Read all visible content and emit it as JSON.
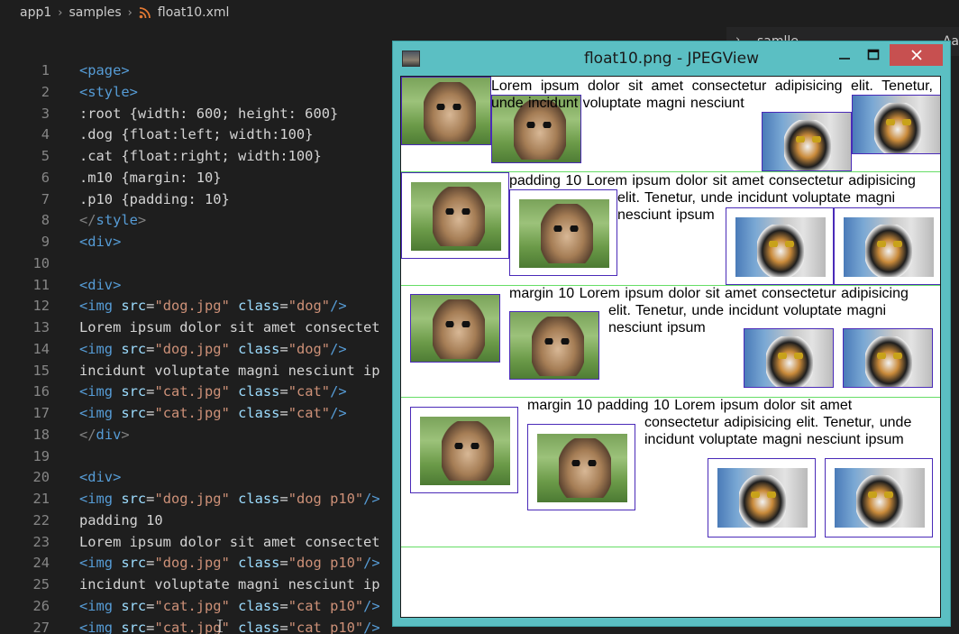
{
  "breadcrumb": {
    "items": [
      "app1",
      "samples",
      "float10.xml"
    ],
    "file_icon": "rss-icon"
  },
  "editor": {
    "lines": [
      {
        "n": "1",
        "segs": [
          [
            "tag",
            "<page>"
          ]
        ]
      },
      {
        "n": "2",
        "segs": [
          [
            "tag",
            "<style>"
          ]
        ]
      },
      {
        "n": "3",
        "segs": [
          [
            "txt",
            ":root {width: 600; height: 600}"
          ]
        ]
      },
      {
        "n": "4",
        "segs": [
          [
            "txt",
            ".dog {float:left; width:100}"
          ]
        ]
      },
      {
        "n": "5",
        "segs": [
          [
            "txt",
            ".cat {float:right; width:100}"
          ]
        ]
      },
      {
        "n": "6",
        "segs": [
          [
            "txt",
            ".m10 {margin: 10}"
          ]
        ]
      },
      {
        "n": "7",
        "segs": [
          [
            "txt",
            ".p10 {padding: 10}"
          ]
        ]
      },
      {
        "n": "8",
        "segs": [
          [
            "punc",
            "</"
          ],
          [
            "tag",
            "style"
          ],
          [
            "punc",
            ">"
          ]
        ]
      },
      {
        "n": "9",
        "segs": [
          [
            "tag",
            "<div>"
          ]
        ]
      },
      {
        "n": "10",
        "segs": []
      },
      {
        "n": "11",
        "segs": [
          [
            "tag",
            "<div>"
          ]
        ]
      },
      {
        "n": "12",
        "segs": [
          [
            "tag",
            "<img "
          ],
          [
            "attr",
            "src"
          ],
          [
            "txt",
            "="
          ],
          [
            "str",
            "\"dog.jpg\""
          ],
          [
            "attr",
            " class"
          ],
          [
            "txt",
            "="
          ],
          [
            "str",
            "\"dog\""
          ],
          [
            "tag",
            "/>"
          ]
        ]
      },
      {
        "n": "13",
        "segs": [
          [
            "txt",
            "Lorem ipsum dolor sit amet consectet"
          ]
        ]
      },
      {
        "n": "14",
        "segs": [
          [
            "tag",
            "<img "
          ],
          [
            "attr",
            "src"
          ],
          [
            "txt",
            "="
          ],
          [
            "str",
            "\"dog.jpg\""
          ],
          [
            "attr",
            " class"
          ],
          [
            "txt",
            "="
          ],
          [
            "str",
            "\"dog\""
          ],
          [
            "tag",
            "/>"
          ]
        ]
      },
      {
        "n": "15",
        "segs": [
          [
            "txt",
            "incidunt voluptate magni nesciunt ip"
          ]
        ]
      },
      {
        "n": "16",
        "segs": [
          [
            "tag",
            "<img "
          ],
          [
            "attr",
            "src"
          ],
          [
            "txt",
            "="
          ],
          [
            "str",
            "\"cat.jpg\""
          ],
          [
            "attr",
            " class"
          ],
          [
            "txt",
            "="
          ],
          [
            "str",
            "\"cat\""
          ],
          [
            "tag",
            "/>"
          ]
        ]
      },
      {
        "n": "17",
        "segs": [
          [
            "tag",
            "<img "
          ],
          [
            "attr",
            "src"
          ],
          [
            "txt",
            "="
          ],
          [
            "str",
            "\"cat.jpg\""
          ],
          [
            "attr",
            " class"
          ],
          [
            "txt",
            "="
          ],
          [
            "str",
            "\"cat\""
          ],
          [
            "tag",
            "/>"
          ]
        ]
      },
      {
        "n": "18",
        "segs": [
          [
            "punc",
            "</"
          ],
          [
            "tag",
            "div"
          ],
          [
            "punc",
            ">"
          ]
        ]
      },
      {
        "n": "19",
        "segs": []
      },
      {
        "n": "20",
        "segs": [
          [
            "tag",
            "<div>"
          ]
        ]
      },
      {
        "n": "21",
        "segs": [
          [
            "tag",
            "<img "
          ],
          [
            "attr",
            "src"
          ],
          [
            "txt",
            "="
          ],
          [
            "str",
            "\"dog.jpg\""
          ],
          [
            "attr",
            " class"
          ],
          [
            "txt",
            "="
          ],
          [
            "str",
            "\"dog p10\""
          ],
          [
            "tag",
            "/>"
          ]
        ]
      },
      {
        "n": "22",
        "segs": [
          [
            "txt",
            "padding 10"
          ]
        ]
      },
      {
        "n": "23",
        "segs": [
          [
            "txt",
            "Lorem ipsum dolor sit amet consectet"
          ]
        ]
      },
      {
        "n": "24",
        "segs": [
          [
            "tag",
            "<img "
          ],
          [
            "attr",
            "src"
          ],
          [
            "txt",
            "="
          ],
          [
            "str",
            "\"dog.jpg\""
          ],
          [
            "attr",
            " class"
          ],
          [
            "txt",
            "="
          ],
          [
            "str",
            "\"dog p10\""
          ],
          [
            "tag",
            "/>"
          ]
        ]
      },
      {
        "n": "25",
        "segs": [
          [
            "txt",
            "incidunt voluptate magni nesciunt ip"
          ]
        ]
      },
      {
        "n": "26",
        "segs": [
          [
            "tag",
            "<img "
          ],
          [
            "attr",
            "src"
          ],
          [
            "txt",
            "="
          ],
          [
            "str",
            "\"cat.jpg\""
          ],
          [
            "attr",
            " class"
          ],
          [
            "txt",
            "="
          ],
          [
            "str",
            "\"cat p10\""
          ],
          [
            "tag",
            "/>"
          ]
        ]
      },
      {
        "n": "27",
        "segs": [
          [
            "tag",
            "<img "
          ],
          [
            "attr",
            "src"
          ],
          [
            "txt",
            "="
          ],
          [
            "str",
            "\"cat.jpg\""
          ],
          [
            "attr",
            " class"
          ],
          [
            "txt",
            "="
          ],
          [
            "str",
            "\"cat p10\""
          ],
          [
            "tag",
            "/>"
          ]
        ]
      }
    ]
  },
  "background_editor": {
    "word": "samlle",
    "aa": "Aa"
  },
  "viewer": {
    "title": "float10.png - JPEGView",
    "min_label": "—",
    "max_label": "☐",
    "close_label": "✕"
  },
  "render": {
    "sec1_text": "Lorem ipsum dolor sit amet consectetur adipisicing elit. Tenetur, unde incidunt voluptate magni nesciunt",
    "sec2_text_l1": "padding 10 Lorem ipsum dolor sit amet consectetur adipisicing",
    "sec2_text_l2": "elit. Tenetur, unde incidunt voluptate magni",
    "sec2_text_l3": "nesciunt ipsum",
    "sec3_text_l1": "margin 10 Lorem ipsum dolor sit amet consectetur adipisicing",
    "sec3_text_l2": "elit. Tenetur, unde incidunt voluptate magni",
    "sec3_text_l3": "nesciunt ipsum",
    "sec4_text_l1": "margin 10 padding 10 Lorem ipsum dolor sit amet",
    "sec4_text_l2": "consectetur adipisicing elit. Tenetur, unde",
    "sec4_text_l3": "incidunt voluptate magni nesciunt ipsum"
  }
}
